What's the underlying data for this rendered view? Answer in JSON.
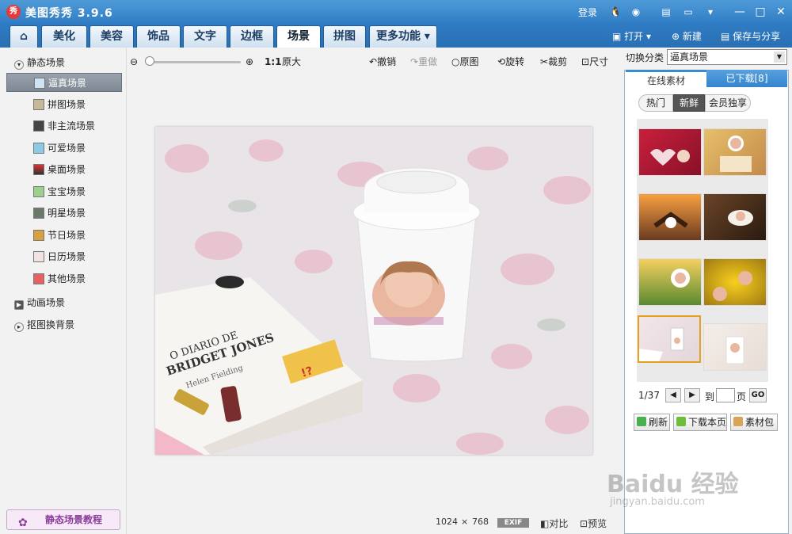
{
  "app": {
    "logo_text": "秀",
    "title": "美图秀秀 3.9.6",
    "login": "登录"
  },
  "tabs": [
    "美化",
    "美容",
    "饰品",
    "文字",
    "边框",
    "场景",
    "拼图",
    "更多功能"
  ],
  "toolbar_right": {
    "open": "打开",
    "new": "新建",
    "save": "保存与分享"
  },
  "tree": {
    "static_root": "静态场景",
    "items": [
      "逼真场景",
      "拼图场景",
      "非主流场景",
      "可爱场景",
      "桌面场景",
      "宝宝场景",
      "明星场景",
      "节日场景",
      "日历场景",
      "其他场景"
    ],
    "animated_root": "动画场景",
    "cutout_root": "抠图换背景"
  },
  "tutorial_button": "静态场景教程",
  "edit_toolbar": {
    "ratio": "1:1",
    "original_size": "原大",
    "undo": "撤销",
    "redo": "重做",
    "original": "原图",
    "rotate": "旋转",
    "crop": "裁剪",
    "size": "尺寸"
  },
  "status": {
    "width": "1024",
    "times": "×",
    "height": "768",
    "exif": "EXIF",
    "compare": "对比",
    "preview": "预览"
  },
  "right_panel": {
    "switch_label": "切换分类",
    "switch_value": "逼真场景",
    "tab_online": "在线素材",
    "tab_downloaded": "已下载[8]",
    "filters": [
      "热门",
      "新鲜",
      "会员独享"
    ],
    "page_text": "1/37",
    "goto_label": "到",
    "page_unit": "页",
    "go": "GO",
    "refresh": "刷新",
    "download_page": "下载本页",
    "material_pack": "素材包"
  },
  "photo": {
    "book_line1": "O DIARIO DE",
    "book_line2": "BRIDGET JONES",
    "book_line3": "Helen Fielding"
  },
  "watermark": {
    "brand": "Baidu 经验",
    "url": "jingyan.baidu.com"
  }
}
